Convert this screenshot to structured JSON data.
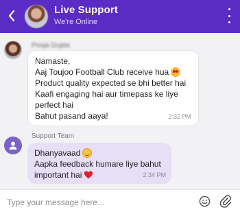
{
  "header": {
    "title": "Live Support",
    "status": "We're Online",
    "back_icon": "chevron-left-icon",
    "menu_icon": "more-vertical-icon",
    "color": "#5b2bc6"
  },
  "messages": [
    {
      "sender": "Pooja Gupta",
      "lines": [
        "Namaste,",
        "Aaj Toujoo Football Club receive hua",
        "Product quality expected se bhi better hai",
        "Kaafi engaging hai aur timepass ke liye",
        "perfect hai",
        "Bahut pasand aaya!"
      ],
      "time": "2:32 PM"
    },
    {
      "sender": "Support Team",
      "lines": [
        "Dhanyavaad",
        "Aapka feedback humare liye bahut",
        "important hai"
      ],
      "time": "2:34 PM"
    }
  ],
  "input": {
    "placeholder": "Type your message here...",
    "value": ""
  },
  "icons": {
    "emoji_button": "smiley-icon",
    "attach_button": "paperclip-icon"
  }
}
